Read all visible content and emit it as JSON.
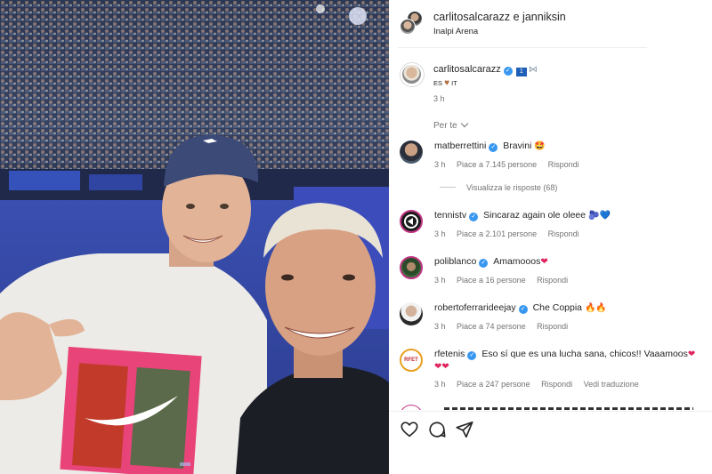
{
  "header": {
    "users": "carlitosalcarazz e janniksin",
    "location": "Inalpi Arena"
  },
  "caption": {
    "username": "carlitosalcarazz",
    "badge_number": "1",
    "text_left": "ES",
    "text_right": "IT",
    "time": "3 h"
  },
  "sort_label": "Per te",
  "comments": [
    {
      "username": "matberrettini",
      "text": "Bravini",
      "emoji": "🤩",
      "time": "3 h",
      "likes": "Piace a 7.145 persone",
      "reply": "Rispondi"
    },
    {
      "username": "tennistv",
      "text": "Sincaraz again ole oleee",
      "emoji": "🫐💙",
      "time": "3 h",
      "likes": "Piace a 2.101 persone",
      "reply": "Rispondi"
    },
    {
      "username": "poliblanco",
      "text": "Amamooos",
      "emoji": "❤",
      "time": "3 h",
      "likes": "Piace a 16 persone",
      "reply": "Rispondi"
    },
    {
      "username": "robertoferraridee​jay",
      "text": "Che Coppia",
      "emoji": "🔥🔥",
      "time": "3 h",
      "likes": "Piace a 74 persone",
      "reply": "Rispondi"
    },
    {
      "username": "rfetenis",
      "text": "Eso sí que es una lucha sana, chicos!! Vaaamoos",
      "emoji": "❤",
      "line2": "❤❤",
      "time": "3 h",
      "likes": "Piace a 247 persone",
      "reply": "Rispondi",
      "translate": "Vedi traduzione"
    }
  ],
  "view_replies": "Visualizza le risposte (68)",
  "avatar_text": {
    "rfet": "RFET"
  },
  "icons": [
    "heart-icon",
    "comment-icon",
    "share-icon"
  ],
  "colors": {
    "verified": "#3897f0",
    "secondary_text": "#737373",
    "heart": "#e0245e"
  }
}
